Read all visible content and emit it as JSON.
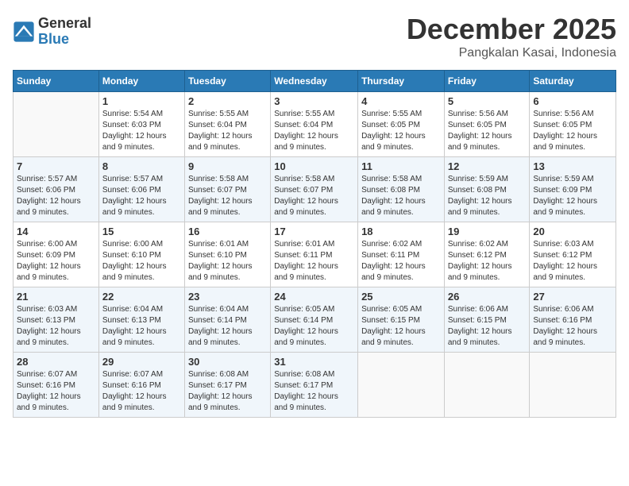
{
  "logo": {
    "general": "General",
    "blue": "Blue"
  },
  "title": "December 2025",
  "location": "Pangkalan Kasai, Indonesia",
  "weekdays": [
    "Sunday",
    "Monday",
    "Tuesday",
    "Wednesday",
    "Thursday",
    "Friday",
    "Saturday"
  ],
  "weeks": [
    [
      {
        "day": "",
        "info": ""
      },
      {
        "day": "1",
        "info": "Sunrise: 5:54 AM\nSunset: 6:03 PM\nDaylight: 12 hours\nand 9 minutes."
      },
      {
        "day": "2",
        "info": "Sunrise: 5:55 AM\nSunset: 6:04 PM\nDaylight: 12 hours\nand 9 minutes."
      },
      {
        "day": "3",
        "info": "Sunrise: 5:55 AM\nSunset: 6:04 PM\nDaylight: 12 hours\nand 9 minutes."
      },
      {
        "day": "4",
        "info": "Sunrise: 5:55 AM\nSunset: 6:05 PM\nDaylight: 12 hours\nand 9 minutes."
      },
      {
        "day": "5",
        "info": "Sunrise: 5:56 AM\nSunset: 6:05 PM\nDaylight: 12 hours\nand 9 minutes."
      },
      {
        "day": "6",
        "info": "Sunrise: 5:56 AM\nSunset: 6:05 PM\nDaylight: 12 hours\nand 9 minutes."
      }
    ],
    [
      {
        "day": "7",
        "info": "Sunrise: 5:57 AM\nSunset: 6:06 PM\nDaylight: 12 hours\nand 9 minutes."
      },
      {
        "day": "8",
        "info": "Sunrise: 5:57 AM\nSunset: 6:06 PM\nDaylight: 12 hours\nand 9 minutes."
      },
      {
        "day": "9",
        "info": "Sunrise: 5:58 AM\nSunset: 6:07 PM\nDaylight: 12 hours\nand 9 minutes."
      },
      {
        "day": "10",
        "info": "Sunrise: 5:58 AM\nSunset: 6:07 PM\nDaylight: 12 hours\nand 9 minutes."
      },
      {
        "day": "11",
        "info": "Sunrise: 5:58 AM\nSunset: 6:08 PM\nDaylight: 12 hours\nand 9 minutes."
      },
      {
        "day": "12",
        "info": "Sunrise: 5:59 AM\nSunset: 6:08 PM\nDaylight: 12 hours\nand 9 minutes."
      },
      {
        "day": "13",
        "info": "Sunrise: 5:59 AM\nSunset: 6:09 PM\nDaylight: 12 hours\nand 9 minutes."
      }
    ],
    [
      {
        "day": "14",
        "info": "Sunrise: 6:00 AM\nSunset: 6:09 PM\nDaylight: 12 hours\nand 9 minutes."
      },
      {
        "day": "15",
        "info": "Sunrise: 6:00 AM\nSunset: 6:10 PM\nDaylight: 12 hours\nand 9 minutes."
      },
      {
        "day": "16",
        "info": "Sunrise: 6:01 AM\nSunset: 6:10 PM\nDaylight: 12 hours\nand 9 minutes."
      },
      {
        "day": "17",
        "info": "Sunrise: 6:01 AM\nSunset: 6:11 PM\nDaylight: 12 hours\nand 9 minutes."
      },
      {
        "day": "18",
        "info": "Sunrise: 6:02 AM\nSunset: 6:11 PM\nDaylight: 12 hours\nand 9 minutes."
      },
      {
        "day": "19",
        "info": "Sunrise: 6:02 AM\nSunset: 6:12 PM\nDaylight: 12 hours\nand 9 minutes."
      },
      {
        "day": "20",
        "info": "Sunrise: 6:03 AM\nSunset: 6:12 PM\nDaylight: 12 hours\nand 9 minutes."
      }
    ],
    [
      {
        "day": "21",
        "info": "Sunrise: 6:03 AM\nSunset: 6:13 PM\nDaylight: 12 hours\nand 9 minutes."
      },
      {
        "day": "22",
        "info": "Sunrise: 6:04 AM\nSunset: 6:13 PM\nDaylight: 12 hours\nand 9 minutes."
      },
      {
        "day": "23",
        "info": "Sunrise: 6:04 AM\nSunset: 6:14 PM\nDaylight: 12 hours\nand 9 minutes."
      },
      {
        "day": "24",
        "info": "Sunrise: 6:05 AM\nSunset: 6:14 PM\nDaylight: 12 hours\nand 9 minutes."
      },
      {
        "day": "25",
        "info": "Sunrise: 6:05 AM\nSunset: 6:15 PM\nDaylight: 12 hours\nand 9 minutes."
      },
      {
        "day": "26",
        "info": "Sunrise: 6:06 AM\nSunset: 6:15 PM\nDaylight: 12 hours\nand 9 minutes."
      },
      {
        "day": "27",
        "info": "Sunrise: 6:06 AM\nSunset: 6:16 PM\nDaylight: 12 hours\nand 9 minutes."
      }
    ],
    [
      {
        "day": "28",
        "info": "Sunrise: 6:07 AM\nSunset: 6:16 PM\nDaylight: 12 hours\nand 9 minutes."
      },
      {
        "day": "29",
        "info": "Sunrise: 6:07 AM\nSunset: 6:16 PM\nDaylight: 12 hours\nand 9 minutes."
      },
      {
        "day": "30",
        "info": "Sunrise: 6:08 AM\nSunset: 6:17 PM\nDaylight: 12 hours\nand 9 minutes."
      },
      {
        "day": "31",
        "info": "Sunrise: 6:08 AM\nSunset: 6:17 PM\nDaylight: 12 hours\nand 9 minutes."
      },
      {
        "day": "",
        "info": ""
      },
      {
        "day": "",
        "info": ""
      },
      {
        "day": "",
        "info": ""
      }
    ]
  ]
}
